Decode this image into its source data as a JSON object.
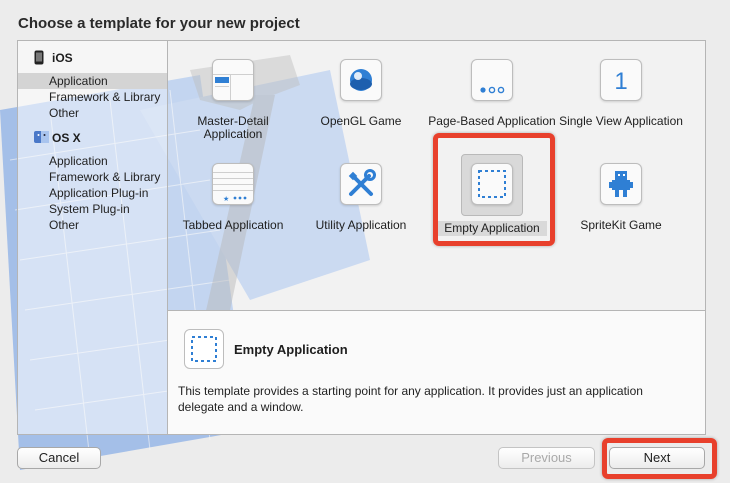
{
  "dialog": {
    "title": "Choose a template for your new project"
  },
  "sidebar": {
    "sections": [
      {
        "label": "iOS",
        "icon": "iphone-icon",
        "items": [
          {
            "label": "Application",
            "selected": true
          },
          {
            "label": "Framework & Library",
            "selected": false
          },
          {
            "label": "Other",
            "selected": false
          }
        ]
      },
      {
        "label": "OS X",
        "icon": "finder-icon",
        "items": [
          {
            "label": "Application",
            "selected": false
          },
          {
            "label": "Framework & Library",
            "selected": false
          },
          {
            "label": "Application Plug-in",
            "selected": false
          },
          {
            "label": "System Plug-in",
            "selected": false
          },
          {
            "label": "Other",
            "selected": false
          }
        ]
      }
    ]
  },
  "templates": [
    {
      "label": "Master-Detail Application",
      "icon": "master-detail-icon"
    },
    {
      "label": "OpenGL Game",
      "icon": "opengl-icon"
    },
    {
      "label": "Page-Based Application",
      "icon": "page-based-icon"
    },
    {
      "label": "Single View Application",
      "icon": "single-view-icon",
      "glyph": "1"
    },
    {
      "label": "Tabbed Application",
      "icon": "tabbed-icon"
    },
    {
      "label": "Utility Application",
      "icon": "utility-icon"
    },
    {
      "label": "Empty Application",
      "icon": "empty-app-icon",
      "selected": true
    },
    {
      "label": "SpriteKit Game",
      "icon": "spritekit-icon"
    }
  ],
  "description": {
    "title": "Empty Application",
    "text": "This template provides a starting point for any application. It provides just an application delegate and a window."
  },
  "buttons": {
    "cancel": "Cancel",
    "previous": "Previous",
    "next": "Next"
  },
  "colors": {
    "highlight": "#e8402c",
    "ios_blue": "#2f7fd4"
  }
}
